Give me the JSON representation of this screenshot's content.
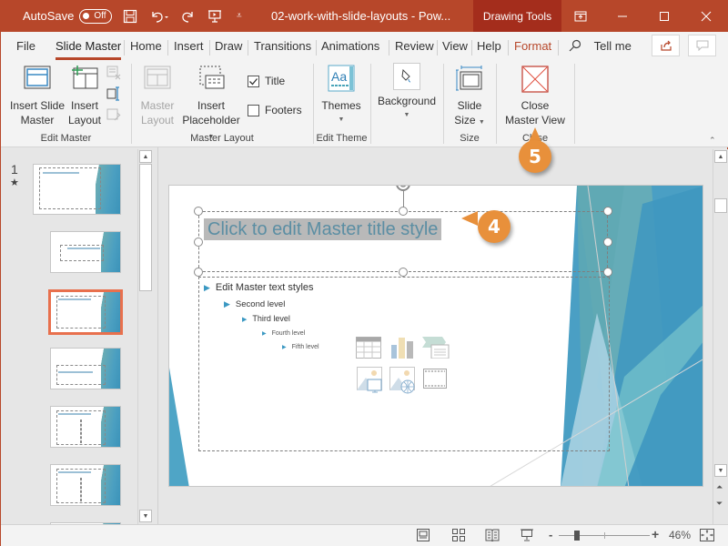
{
  "titlebar": {
    "autosave_label": "AutoSave",
    "autosave_state": "Off",
    "document_title": "02-work-with-slide-layouts  -  Pow...",
    "contextual_tab": "Drawing Tools",
    "accent_color": "#b7472a"
  },
  "tabs": [
    {
      "label": "File"
    },
    {
      "label": "Slide Master",
      "active": true
    },
    {
      "label": "Home"
    },
    {
      "label": "Insert"
    },
    {
      "label": "Draw"
    },
    {
      "label": "Transitions"
    },
    {
      "label": "Animations"
    },
    {
      "label": "Review"
    },
    {
      "label": "View"
    },
    {
      "label": "Help"
    },
    {
      "label": "Format",
      "contextual": true
    }
  ],
  "tell_me": "Tell me",
  "ribbon": {
    "edit_master": {
      "label": "Edit Master",
      "insert_slide_master_1": "Insert Slide",
      "insert_slide_master_2": "Master",
      "insert_layout_1": "Insert",
      "insert_layout_2": "Layout"
    },
    "master_layout": {
      "label": "Master Layout",
      "master_layout_1": "Master",
      "master_layout_2": "Layout",
      "insert_placeholder_1": "Insert",
      "insert_placeholder_2": "Placeholder",
      "title_checkbox": "Title",
      "title_checked": true,
      "footers_checkbox": "Footers",
      "footers_checked": false
    },
    "edit_theme": {
      "label": "Edit Theme",
      "themes": "Themes",
      "background": "Background"
    },
    "size": {
      "label": "Size",
      "slide_size_1": "Slide",
      "slide_size_2": "Size"
    },
    "close": {
      "label": "Close",
      "close_master_1": "Close",
      "close_master_2": "Master View"
    }
  },
  "thumbnails": {
    "slide_number": "1",
    "star": "★",
    "selected_index": 2
  },
  "slide": {
    "title": "Click to edit Master title style",
    "levels": [
      "Edit Master text styles",
      "Second level",
      "Third level",
      "Fourth level",
      "Fifth level"
    ]
  },
  "callouts": {
    "step4": "4",
    "step5": "5"
  },
  "statusbar": {
    "zoom_minus": "-",
    "zoom_plus": "+",
    "zoom_percent": "46%",
    "zoom_fraction": 0.46
  }
}
